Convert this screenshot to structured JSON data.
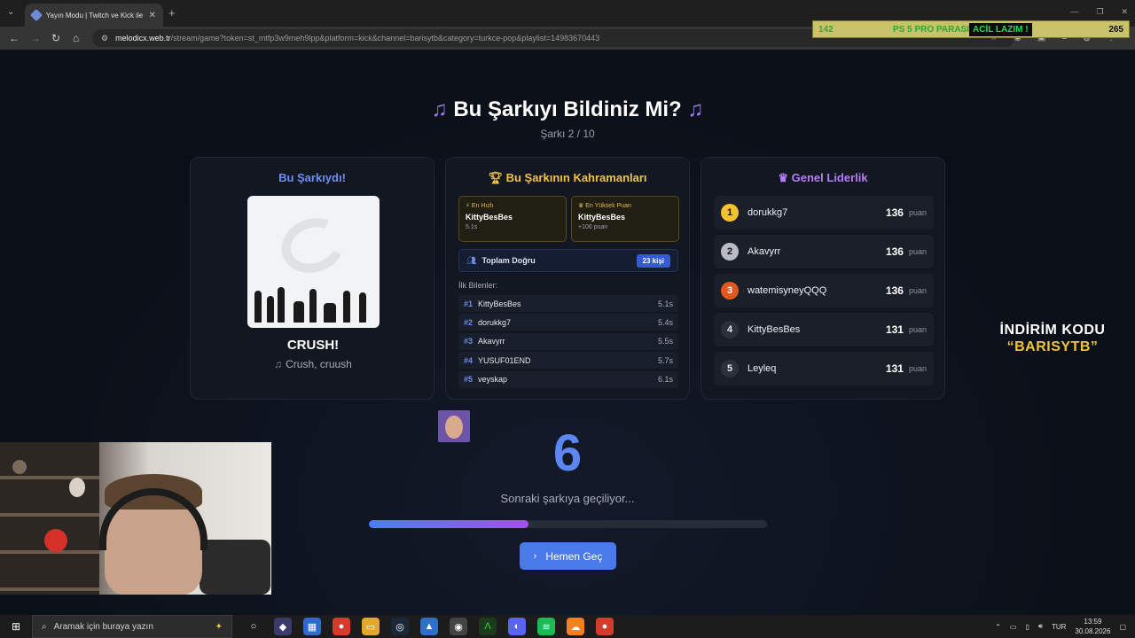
{
  "browser": {
    "tab_title": "Yayın Modu | Twitch ve Kick ile",
    "url_host": "melodicx.web.tr",
    "url_path": "/stream/game?token=st_mtfp3w9meh9lpp&platform=kick&channel=barisytb&category=turkce-pop&playlist=14983670443"
  },
  "ticker": {
    "left": "142",
    "mid": "PS 5 PRO PARASI",
    "right": "ACİL LAZIM !",
    "count": "265"
  },
  "game": {
    "title": "Bu Şarkıyı Bildiniz Mi?",
    "note_icon": "♫",
    "progress_text": "Şarkı 2 / 10"
  },
  "song_card": {
    "heading": "Bu Şarkıydı!",
    "song_title": "CRUSH!",
    "artist": "Crush, cruush"
  },
  "heroes_card": {
    "heading": "Bu Şarkının Kahramanları",
    "fastest": {
      "label": "En Hızlı",
      "name": "KittyBesBes",
      "sub": "5.1s"
    },
    "highest": {
      "label": "En Yüksek Puan",
      "name": "KittyBesBes",
      "sub": "+106 puan"
    },
    "total_label": "Toplam Doğru",
    "total_badge": "23 kişi",
    "first_label": "İlk Bilenler:",
    "first_guessers": [
      {
        "pos": "#1",
        "name": "KittyBesBes",
        "time": "5.1s"
      },
      {
        "pos": "#2",
        "name": "dorukkg7",
        "time": "5.4s"
      },
      {
        "pos": "#3",
        "name": "Akavyrr",
        "time": "5.5s"
      },
      {
        "pos": "#4",
        "name": "YUSUF01END",
        "time": "5.7s"
      },
      {
        "pos": "#5",
        "name": "veyskap",
        "time": "6.1s"
      }
    ]
  },
  "leader_card": {
    "heading": "Genel Liderlik",
    "unit": "puan",
    "rows": [
      {
        "rank": "1",
        "name": "dorukkg7",
        "score": "136",
        "color": "#f2c230"
      },
      {
        "rank": "2",
        "name": "Akavyrr",
        "score": "136",
        "color": "#b9bcc4"
      },
      {
        "rank": "3",
        "name": "watemisyneyQQQ",
        "score": "136",
        "color": "#e2561f"
      },
      {
        "rank": "4",
        "name": "KittyBesBes",
        "score": "131",
        "color": "#2a303c"
      },
      {
        "rank": "5",
        "name": "Leyleq",
        "score": "131",
        "color": "#2a303c"
      }
    ]
  },
  "countdown": {
    "value": "6",
    "text": "Sonraki şarkıya geçiliyor...",
    "progress_fraction": 0.4,
    "skip_label": "Hemen Geç"
  },
  "promo": {
    "line1": "İNDİRİM KODU",
    "line2": "“BARISYTB”"
  },
  "taskbar": {
    "search_placeholder": "Aramak için buraya yazın",
    "lang": "TUR",
    "time": "13:59",
    "date": "30.08.2026"
  },
  "colors": {
    "accent": "#4a79ea",
    "gold": "#f0c44a",
    "purple": "#b67df5"
  }
}
